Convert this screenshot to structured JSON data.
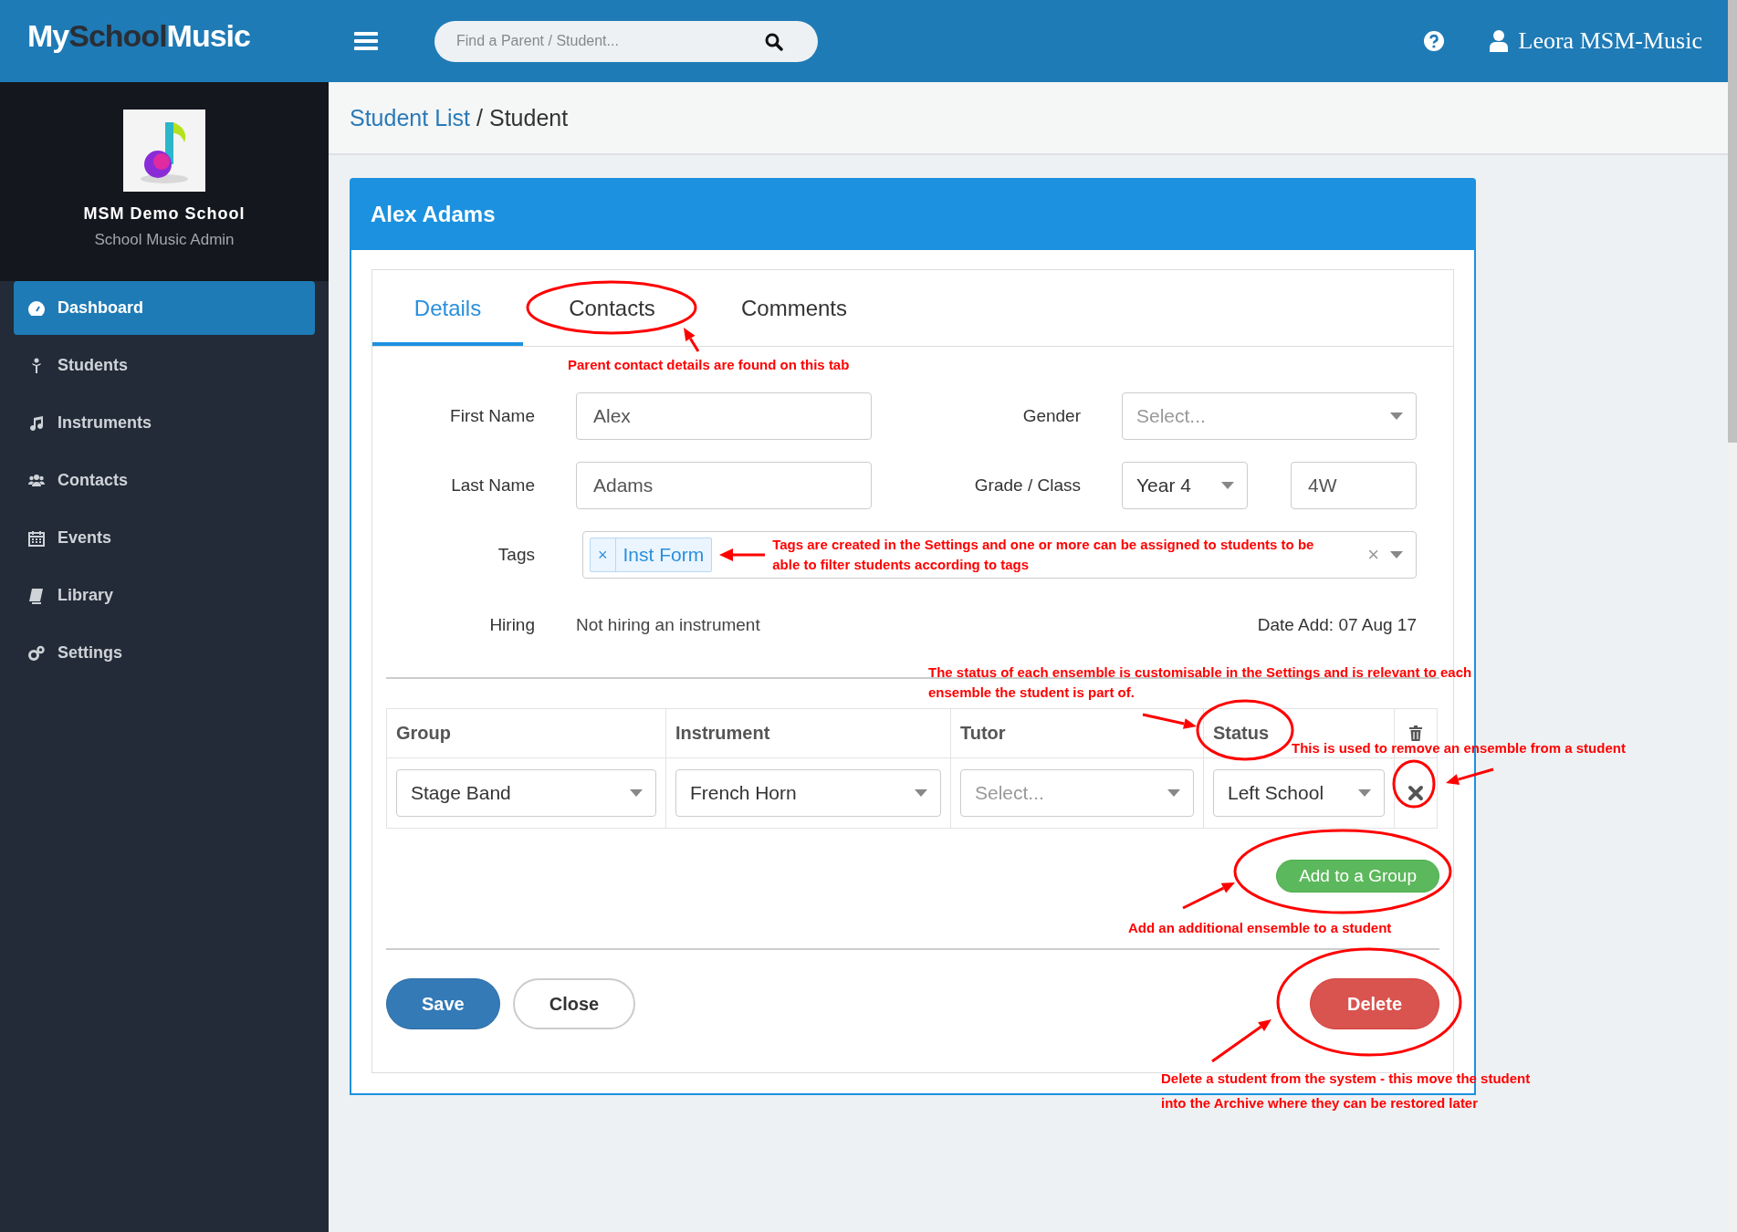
{
  "header": {
    "logo": [
      {
        "text": "My",
        "dark": false
      },
      {
        "text": "School",
        "dark": true
      },
      {
        "text": "Music",
        "dark": false
      }
    ],
    "search": {
      "placeholder": "Find a Parent / Student..."
    },
    "user": {
      "name": "Leora MSM-Music"
    }
  },
  "sidebar": {
    "school": {
      "name": "MSM Demo School",
      "role": "School Music Admin"
    },
    "items": [
      {
        "label": "Dashboard",
        "selected": true
      },
      {
        "label": "Students",
        "selected": false
      },
      {
        "label": "Instruments",
        "selected": false
      },
      {
        "label": "Contacts",
        "selected": false
      },
      {
        "label": "Events",
        "selected": false
      },
      {
        "label": "Library",
        "selected": false
      },
      {
        "label": "Settings",
        "selected": false
      }
    ]
  },
  "breadcrumb": {
    "link": "Student List",
    "separator": "/",
    "current": "Student"
  },
  "card": {
    "title": "Alex Adams",
    "tabs": [
      {
        "label": "Details",
        "selected": true
      },
      {
        "label": "Contacts",
        "selected": false
      },
      {
        "label": "Comments",
        "selected": false
      }
    ],
    "form": {
      "first_name": {
        "label": "First Name",
        "value": "Alex"
      },
      "gender": {
        "label": "Gender",
        "placeholder": "Select..."
      },
      "last_name": {
        "label": "Last Name",
        "value": "Adams"
      },
      "grade_class": {
        "label": "Grade / Class",
        "grade": "Year 4",
        "class": "4W"
      },
      "tags": {
        "label": "Tags",
        "items": [
          {
            "remove": "×",
            "label": "Inst Form"
          }
        ],
        "clear": "×"
      },
      "hiring": {
        "label": "Hiring",
        "value": "Not hiring an instrument"
      },
      "date_added": "Date Add: 07 Aug 17"
    },
    "ensembles": {
      "columns": [
        "Group",
        "Instrument",
        "Tutor",
        "Status"
      ],
      "rows": [
        {
          "cells": [
            {
              "value": "Stage Band"
            },
            {
              "value": "French Horn"
            },
            {
              "placeholder": "Select..."
            },
            {
              "value": "Left School"
            }
          ]
        }
      ],
      "add_button": "Add to a Group"
    },
    "actions": {
      "save": "Save",
      "close": "Close",
      "delete": "Delete"
    }
  },
  "annotations": [
    {
      "text": "Parent contact details are found on this tab"
    },
    {
      "text": "Tags are created in the Settings and one or more can be assigned to students to be able to filter students according to tags"
    },
    {
      "text": "The status of each ensemble is customisable in the Settings and is relevant to each ensemble the student is part of."
    },
    {
      "text": "This is used to remove an ensemble from a student"
    },
    {
      "text": "Add an additional ensemble to a student"
    },
    {
      "text": "Delete a student from the system - this move the student into the Archive where they can be restored later"
    }
  ]
}
